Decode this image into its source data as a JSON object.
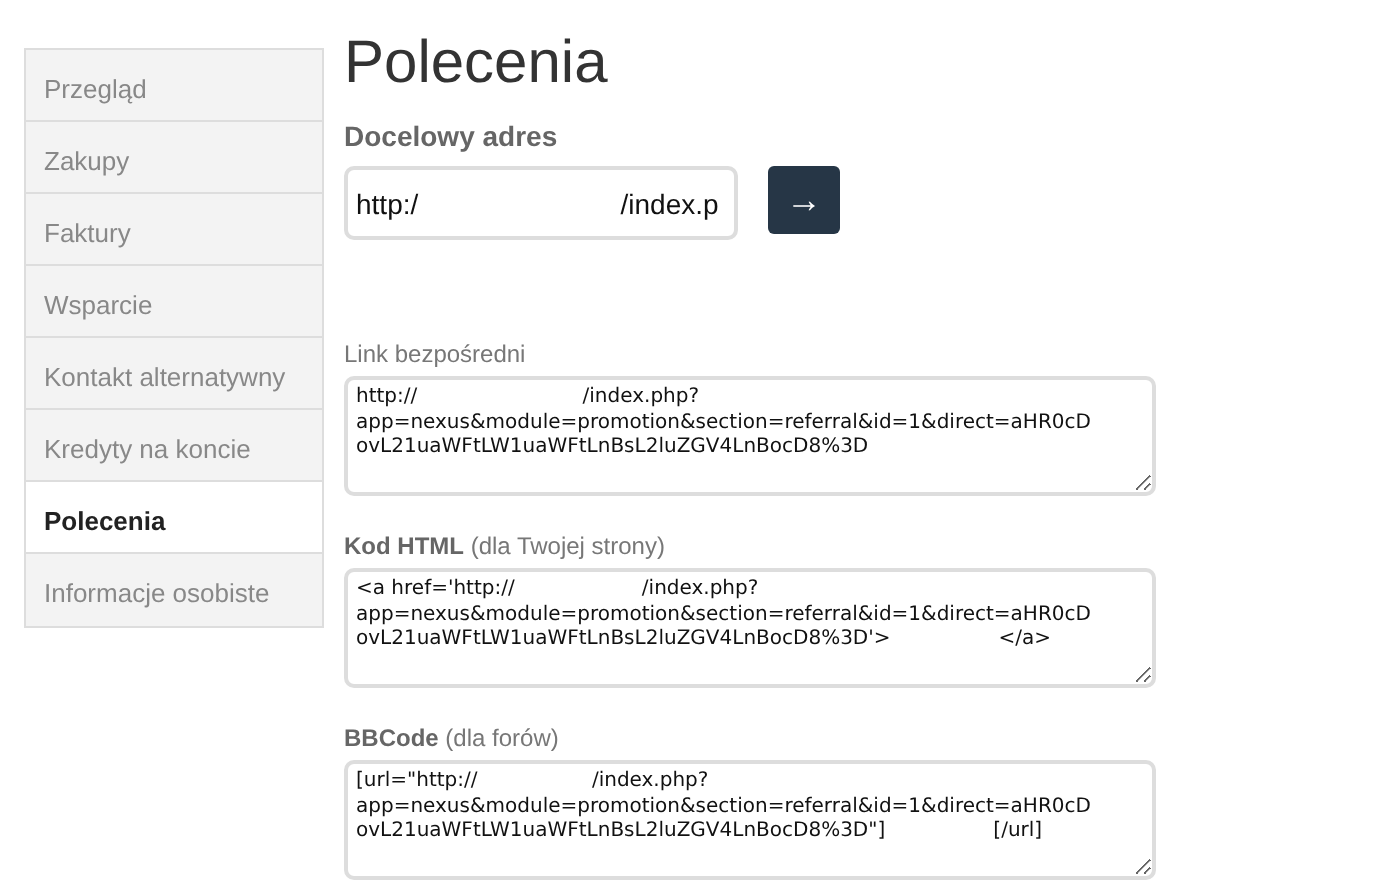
{
  "sidebar": {
    "items": [
      {
        "label": "Przegląd",
        "selected": false
      },
      {
        "label": "Zakupy",
        "selected": false
      },
      {
        "label": "Faktury",
        "selected": false
      },
      {
        "label": "Wsparcie",
        "selected": false
      },
      {
        "label": "Kontakt alternatywny",
        "selected": false
      },
      {
        "label": "Kredyty na koncie",
        "selected": false
      },
      {
        "label": "Polecenia",
        "selected": true
      },
      {
        "label": "Informacje osobiste",
        "selected": false
      }
    ]
  },
  "page_title": "Polecenia",
  "target": {
    "label": "Docelowy adres",
    "value": "http:/                          /index.p",
    "button": "→"
  },
  "fields": [
    {
      "label": "Link bezpośredni",
      "value": "http://                          /index.php?\napp=nexus&module=promotion&section=referral&id=1&direct=aHR0cD\novL21uaWFtLW1uaWFtLnBsL2luZGV4LnBocD8%3D"
    },
    {
      "label": "**Kod HTML** (dla Twojej strony)",
      "value": "<a href='http://                    /index.php?\napp=nexus&module=promotion&section=referral&id=1&direct=aHR0cD\novL21uaWFtLW1uaWFtLnBsL2luZGV4LnBocD8%3D'>                 </a>"
    },
    {
      "label": "**BBCode** (dla forów)",
      "value": "[url=\"http://                  /index.php?\napp=nexus&module=promotion&section=referral&id=1&direct=aHR0cD\novL21uaWFtLW1uaWFtLnBsL2luZGV4LnBocD8%3D\"]                 [/url]"
    }
  ]
}
